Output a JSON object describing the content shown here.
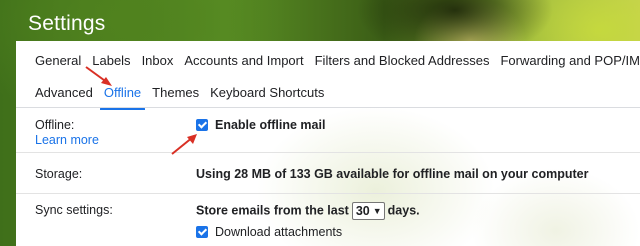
{
  "app": {
    "title": "Settings"
  },
  "tabs": {
    "row1": [
      {
        "label": "General"
      },
      {
        "label": "Labels"
      },
      {
        "label": "Inbox"
      },
      {
        "label": "Accounts and Import"
      },
      {
        "label": "Filters and Blocked Addresses"
      },
      {
        "label": "Forwarding and POP/IMAP"
      }
    ],
    "row2": [
      {
        "label": "Advanced"
      },
      {
        "label": "Offline",
        "active": true
      },
      {
        "label": "Themes"
      },
      {
        "label": "Keyboard Shortcuts"
      }
    ]
  },
  "offline": {
    "label": "Offline:",
    "learn_more": "Learn more",
    "enable_label": "Enable offline mail",
    "enable_checked": true
  },
  "storage": {
    "label": "Storage:",
    "text": "Using 28 MB of 133 GB available for offline mail on your computer"
  },
  "sync": {
    "label": "Sync settings:",
    "prefix": "Store emails from the last",
    "days_value": "30",
    "suffix": "days.",
    "download_label": "Download attachments",
    "download_checked": true
  },
  "colors": {
    "accent": "#1a73e8",
    "annotation_arrow": "#d93025"
  }
}
